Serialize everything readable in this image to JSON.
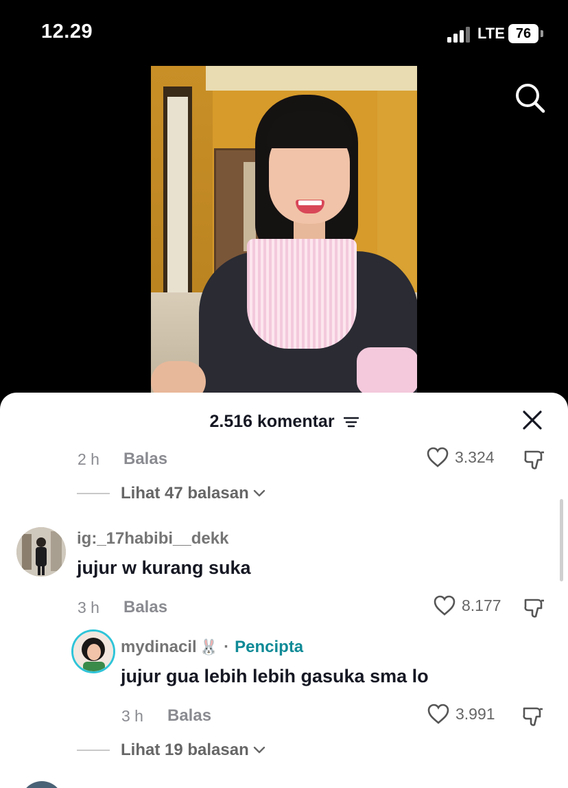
{
  "status_bar": {
    "time": "12.29",
    "network": "LTE",
    "battery": "76"
  },
  "comments_sheet": {
    "title": "2.516 komentar",
    "thread_top": {
      "time": "2 h",
      "reply_label": "Balas",
      "likes": "3.324",
      "view_replies": "Lihat 47 balasan"
    },
    "comment": {
      "username": "ig:_17habibi__dekk",
      "text": "jujur w kurang suka",
      "time": "3 h",
      "reply_label": "Balas",
      "likes": "8.177"
    },
    "creator_reply": {
      "username": "mydinacil",
      "username_emoji": "🐰",
      "separator": "·",
      "badge": "Pencipta",
      "text": "jujur gua lebih lebih gasuka sma lo",
      "time": "3 h",
      "reply_label": "Balas",
      "likes": "3.991"
    },
    "view_replies_2": "Lihat 19 balasan"
  },
  "colors": {
    "creator_badge": "#0f8a96",
    "sheet_bg": "#ffffff",
    "app_bg": "#000000"
  }
}
